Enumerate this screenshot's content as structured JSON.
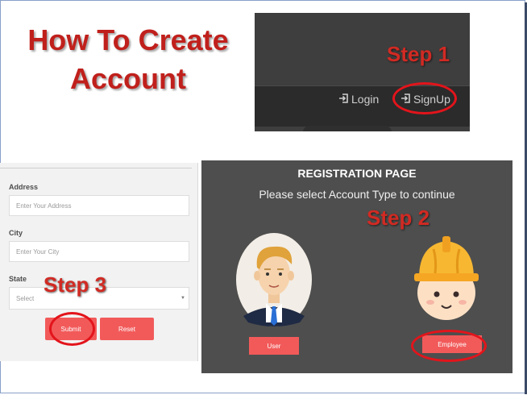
{
  "slide": {
    "title_line1": "How To Create",
    "title_line2": "Account",
    "accent_color": "#d12a23"
  },
  "steps": {
    "step1": "Step 1",
    "step2": "Step 2",
    "step3": "Step 3"
  },
  "navbar": {
    "login_label": "Login",
    "signup_label": "SignUp",
    "login_icon": "sign-in-icon",
    "signup_icon": "sign-in-icon"
  },
  "registration": {
    "title": "REGISTRATION PAGE",
    "subtitle": "Please select Account Type to continue",
    "user_button": "User",
    "employee_button": "Employee"
  },
  "form": {
    "address_label": "Address",
    "address_placeholder": "Enter Your Address",
    "city_label": "City",
    "city_placeholder": "Enter Your City",
    "state_label": "State",
    "state_value": "Select",
    "submit_button": "Submit",
    "reset_button": "Reset"
  }
}
